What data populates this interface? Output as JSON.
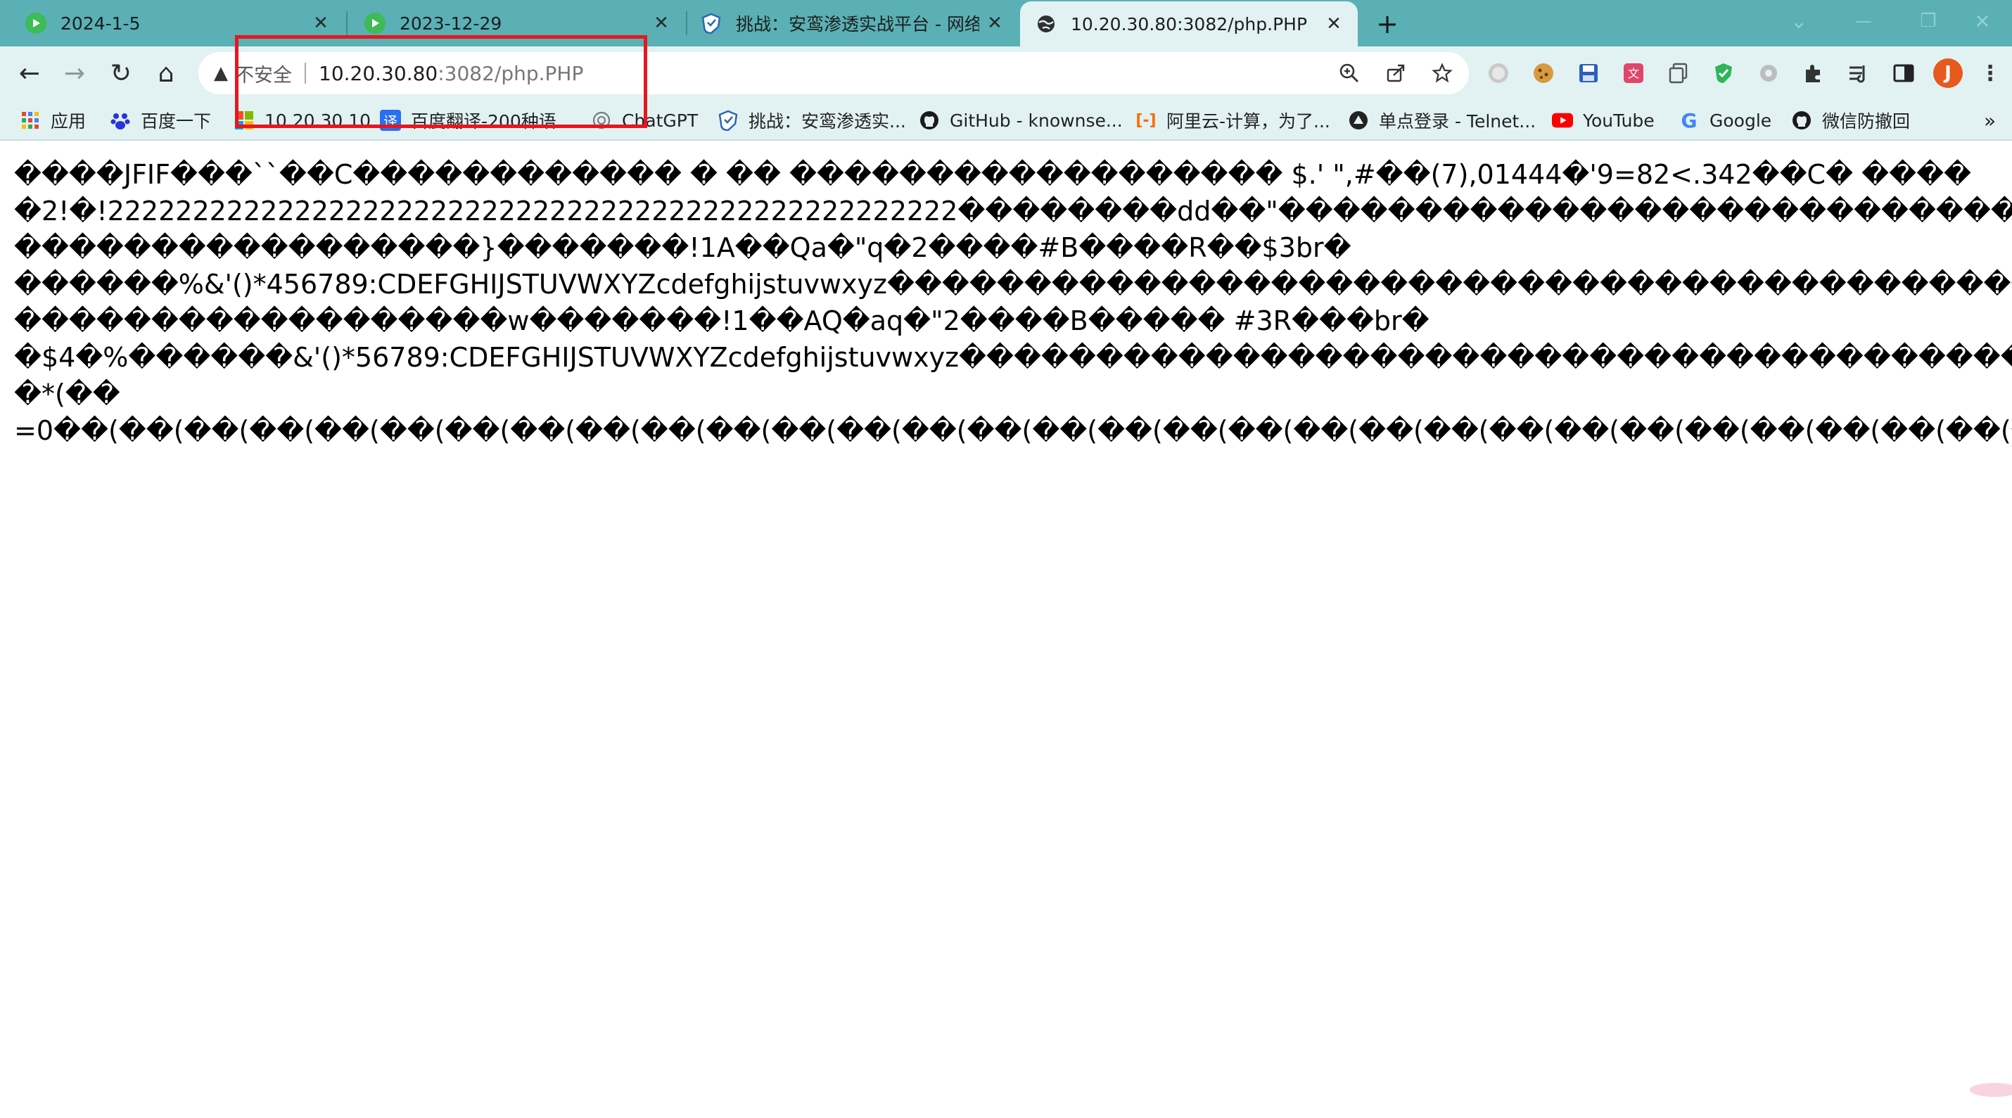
{
  "tabs": [
    {
      "title": "2024-1-5",
      "icon": "play-icon",
      "close": "✕",
      "active": false
    },
    {
      "title": "2023-12-29",
      "icon": "play-icon",
      "close": "✕",
      "active": false
    },
    {
      "title": "挑战：安鸾渗透实战平台 - 网络安",
      "icon": "shield-icon",
      "close": "✕",
      "active": false
    },
    {
      "title": "10.20.30.80:3082/php.PHP",
      "icon": "globe-icon",
      "close": "✕",
      "active": true
    }
  ],
  "new_tab": "+",
  "window_controls": {
    "minimize": "—",
    "restore": "❐",
    "close": "✕",
    "dropdown": "⌄"
  },
  "toolbar": {
    "back": "←",
    "forward": "→",
    "reload": "↻",
    "home": "⌂"
  },
  "address": {
    "security_label": "不安全",
    "warning_glyph": "▲",
    "host": "10.20.30.80",
    "path": ":3082/php.PHP"
  },
  "profile": {
    "initial": "J",
    "color": "#e8591d"
  },
  "bookmarks": [
    {
      "label": "应用",
      "icon": "apps-grid-icon"
    },
    {
      "label": "百度一下",
      "icon": "baidu-paw-icon"
    },
    {
      "label": "10.20.30.10",
      "icon": "windows-logo-icon"
    },
    {
      "label": "百度翻译-200种语...",
      "icon": "translate-icon"
    },
    {
      "label": "ChatGPT",
      "icon": "openai-icon"
    },
    {
      "label": "挑战：安鸾渗透实...",
      "icon": "shield-icon"
    },
    {
      "label": "GitHub - knownse...",
      "icon": "github-icon"
    },
    {
      "label": "阿里云-计算，为了...",
      "icon": "aliyun-icon"
    },
    {
      "label": "单点登录 - Telnet...",
      "icon": "sso-icon"
    },
    {
      "label": "YouTube",
      "icon": "youtube-icon"
    },
    {
      "label": "Google",
      "icon": "google-icon"
    },
    {
      "label": "微信防撤回",
      "icon": "github-icon"
    }
  ],
  "bookmarks_more": "»",
  "colors": {
    "tabstrip": "#5ab0b4",
    "toolbar": "#e2f2f3",
    "highlight": "#e8161f"
  },
  "page_body": [
    "����JFIF���``��C������������ � �� ������������������ $.' \",#��(7),01444�'9=82<.342��C� ����",
    "�2!�!22222222222222222222222222222222222222222222222222��������dd��\"�������������������������������� �",
    "�����������������}�������!1A��Qa�\"q�2����#B����R��$3br�",
    "������%&'()*456789:CDEFGHIJSTUVWXYZcdefghijstuvwxyz��������������������������������������������������������������",
    "������������������w�������!1��AQ�aq�\"2����B����� #3R���br�",
    "�$4�%������&'()*56789:CDEFGHIJSTUVWXYZcdefghijstuvwxyz��������������������������������������������������������",
    "�*(��",
    "=0��(��(��(��(��(��(��(��(��(��(��(��(��(��(��(��(��(��(��(��(��(��(��(��(��(��(��(��(��(��(��(��(��(��(��("
  ]
}
